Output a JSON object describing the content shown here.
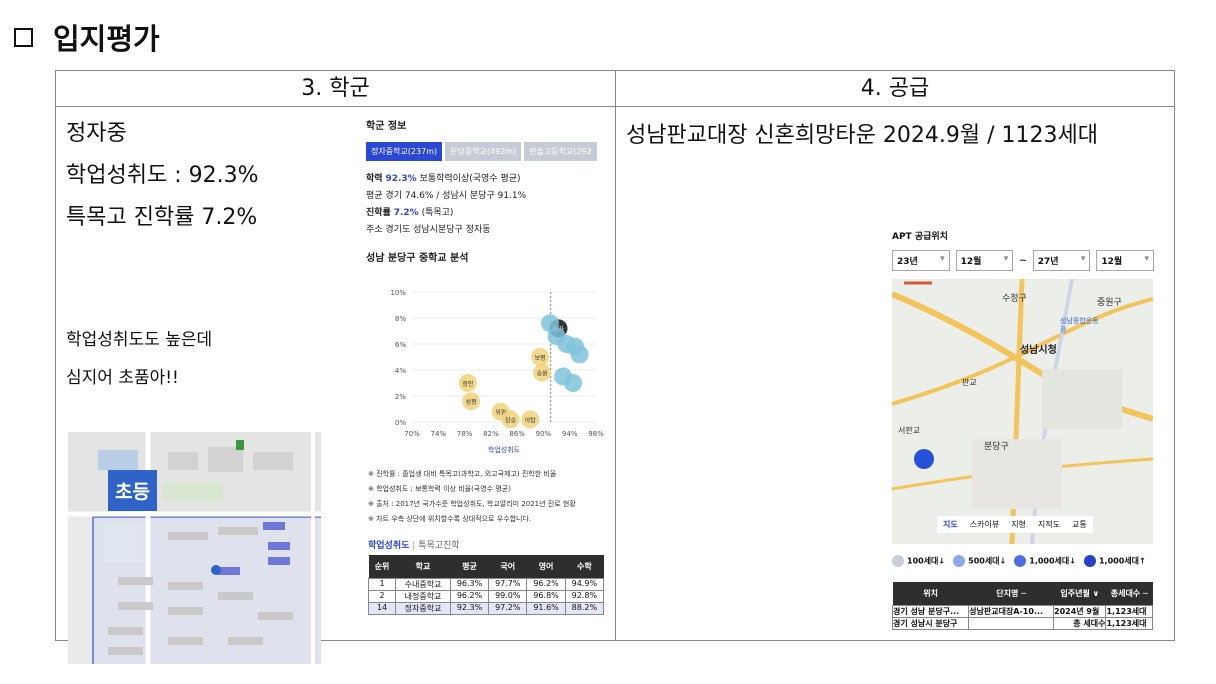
{
  "title": "입지평가",
  "sections": {
    "school_header": "3. 학군",
    "supply_header": "4. 공급"
  },
  "school": {
    "name": "정자중",
    "achievement": "학업성취도 : 92.3%",
    "special_rate": "특목고 진학률 7.2%",
    "note1": "학업성취도도 높은데",
    "note2": "심지어 초품아!!",
    "badge": "초등",
    "panel": {
      "heading": "학군 정보",
      "tabs": [
        "정자중학교(237m)",
        "분당중학교(492m)",
        "판솔고등학교(292"
      ],
      "line1_label": "학력",
      "line1_value": "92.3%",
      "line1_rest": "보통학력이상(국영수 평균)",
      "line2": "평균 경기 74.6% / 성남시 분당구 91.1%",
      "line3_label": "진학률",
      "line3_value": "7.2%",
      "line3_rest": "(특목고)",
      "line4": "주소 경기도 성남시분당구 정자동",
      "chart_heading": "성남 분당구 중학교 분석",
      "xlabel": "학업성취도",
      "notes": [
        "※ 진학률 : 졸업생 대비 특목고(과학고, 외고국제고) 진학한 비율",
        "※ 학업성취도 : 보통학력 이상 비율(국영수 평균)",
        "※ 출처 : 2017년 국가수준 학업성취도, 학교알리미 2021년 진로 현황",
        "※ 차트 우측 상단에 위치할수록 상대적으로 우수합니다."
      ],
      "table_tabs": [
        "학업성취도",
        "특목고진학"
      ],
      "table_headers": [
        "순위",
        "학교",
        "평균",
        "국어",
        "영어",
        "수학"
      ],
      "table_rows": [
        [
          "1",
          "수내중학교",
          "96.3%",
          "97.7%",
          "96.2%",
          "94.9%"
        ],
        [
          "2",
          "내정중학교",
          "96.2%",
          "99.0%",
          "96.8%",
          "92.8%"
        ],
        [
          "14",
          "정자중학교",
          "92.3%",
          "97.2%",
          "91.6%",
          "88.2%"
        ]
      ]
    }
  },
  "chart_data": {
    "type": "scatter",
    "title": "성남 분당구 중학교 분석",
    "xlabel": "학업성취도",
    "ylabel": "",
    "x_ticks": [
      "70%",
      "74%",
      "78%",
      "82%",
      "86%",
      "90%",
      "94%",
      "98%"
    ],
    "y_ticks": [
      "10%",
      "8%",
      "6%",
      "4%",
      "2%",
      "0%"
    ],
    "xlim": [
      70,
      98
    ],
    "ylim": [
      0,
      10
    ],
    "points": [
      {
        "x": 92.3,
        "y": 7.2,
        "label": "정자",
        "group": "highlight"
      },
      {
        "x": 91.0,
        "y": 7.6,
        "label": "",
        "group": "blue"
      },
      {
        "x": 92.0,
        "y": 6.6,
        "label": "",
        "group": "blue"
      },
      {
        "x": 93.5,
        "y": 6.0,
        "label": "",
        "group": "blue"
      },
      {
        "x": 94.8,
        "y": 5.8,
        "label": "",
        "group": "blue"
      },
      {
        "x": 95.5,
        "y": 5.2,
        "label": "",
        "group": "blue"
      },
      {
        "x": 93.0,
        "y": 3.5,
        "label": "",
        "group": "blue"
      },
      {
        "x": 94.5,
        "y": 3.0,
        "label": "",
        "group": "blue"
      },
      {
        "x": 89.5,
        "y": 5.0,
        "label": "보평",
        "group": "yellow"
      },
      {
        "x": 89.8,
        "y": 3.8,
        "label": "송원",
        "group": "yellow"
      },
      {
        "x": 78.5,
        "y": 3.0,
        "label": "장안",
        "group": "yellow"
      },
      {
        "x": 79.0,
        "y": 1.6,
        "label": "성평",
        "group": "yellow"
      },
      {
        "x": 83.5,
        "y": 0.8,
        "label": "위판",
        "group": "yellow"
      },
      {
        "x": 85.0,
        "y": 0.2,
        "label": "장송",
        "group": "yellow"
      },
      {
        "x": 88.0,
        "y": 0.2,
        "label": "야탑",
        "group": "yellow"
      }
    ]
  },
  "supply": {
    "headline": "성남판교대장 신혼희망타운 2024.9월 / 1123세대",
    "panel_heading": "APT 공급위치",
    "selects": [
      "23년",
      "12월",
      "27년",
      "12월"
    ],
    "tilde": "~",
    "map_labels": [
      "수정구",
      "중원구",
      "성남시청",
      "분당구",
      "판교",
      "서판교",
      "성남종합운동장"
    ],
    "map_tabs": [
      "지도",
      "스카이뷰",
      "지형",
      "지적도",
      "교통"
    ],
    "legend": [
      "100세대↓",
      "500세대↓",
      "1,000세대↓",
      "1,000세대↑"
    ],
    "table_headers": [
      "위치",
      "단지명 ─",
      "입주년월 ∨",
      "총세대수 ─"
    ],
    "table_rows": [
      [
        "경기 성남 분당구...",
        "성남판교대장A-10...",
        "2024년 9월",
        "1,123세대"
      ],
      [
        "경기 성남시 분당구",
        "",
        "총 세대수",
        "1,123세대"
      ]
    ]
  }
}
